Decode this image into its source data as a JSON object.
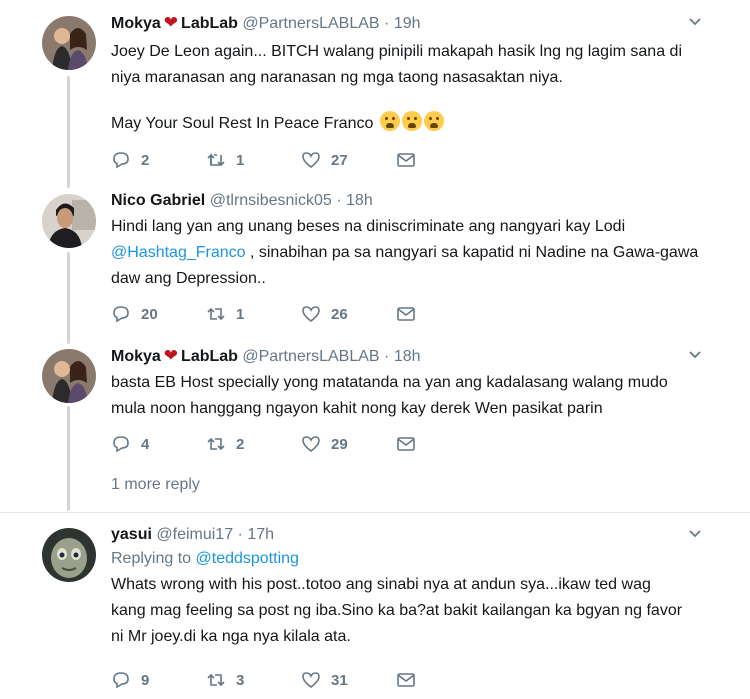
{
  "tweets": [
    {
      "name": "Mokya",
      "name_suffix": "LabLab",
      "handle": "@PartnersLABLAB",
      "time": "19h",
      "text_line1": "Joey De Leon again... BITCH walang pinipili makapah hasik lng ng lagim sana di",
      "text_line2": "niya maranasan ang naranasan ng mga taong nasasaktan niya.",
      "text_line3": "May Your Soul Rest In Peace Franco",
      "replies": "2",
      "retweets": "1",
      "likes": "27"
    },
    {
      "name": "Nico Gabriel",
      "handle": "@tlrnsibesnick05",
      "time": "18h",
      "text_line1": "Hindi lang yan ang unang beses na diniscriminate ang nangyari kay Lodi",
      "mention": "@Hashtag_Franco",
      "text_line2_rest": " , sinabihan pa sa nangyari sa kapatid ni Nadine na Gawa-gawa",
      "text_line3": "daw ang Depression..",
      "replies": "20",
      "retweets": "1",
      "likes": "26"
    },
    {
      "name": "Mokya",
      "name_suffix": "LabLab",
      "handle": "@PartnersLABLAB",
      "time": "18h",
      "text_line1": "basta EB Host specially yong matatanda na yan ang kadalasang walang mudo",
      "text_line2": "mula noon hanggang ngayon kahit nong kay derek Wen pasikat parin",
      "replies": "4",
      "retweets": "2",
      "likes": "29"
    },
    {
      "name": "yasui",
      "handle": "@feimui17",
      "time": "17h",
      "replying_prefix": "Replying to",
      "replying_to": "@teddspotting",
      "text_line1": "Whats wrong with his post..totoo ang sinabi nya at andun sya...ikaw ted wag",
      "text_line2": "kang mag feeling sa post ng iba.Sino ka ba?at bakit kailangan ka bgyan ng favor",
      "text_line3": "ni Mr joey.di ka nga nya kilala ata.",
      "replies": "9",
      "retweets": "3",
      "likes": "31"
    }
  ],
  "separator": "·",
  "more_replies": "1 more reply",
  "icons": [
    "reply-icon",
    "retweet-icon",
    "like-icon",
    "dm-icon",
    "chevron-down-icon",
    "heart-emoji",
    "crying-emoji"
  ],
  "colors": {
    "link": "#1b95e0",
    "muted": "#657786",
    "heart": "#c1121f",
    "thread": "#cfd6db"
  }
}
